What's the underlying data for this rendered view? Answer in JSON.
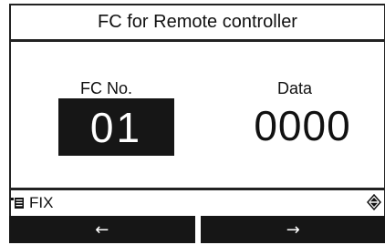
{
  "header": {
    "title": "FC for Remote controller"
  },
  "fields": {
    "fc_no": {
      "label": "FC No.",
      "value": "01"
    },
    "data": {
      "label": "Data",
      "value": "0000"
    }
  },
  "status": {
    "fix_label": "FIX",
    "fix_icon": "menu-list-icon",
    "updown_icon": "up-down-icon"
  },
  "nav": {
    "left_label": "←",
    "right_label": "→"
  }
}
